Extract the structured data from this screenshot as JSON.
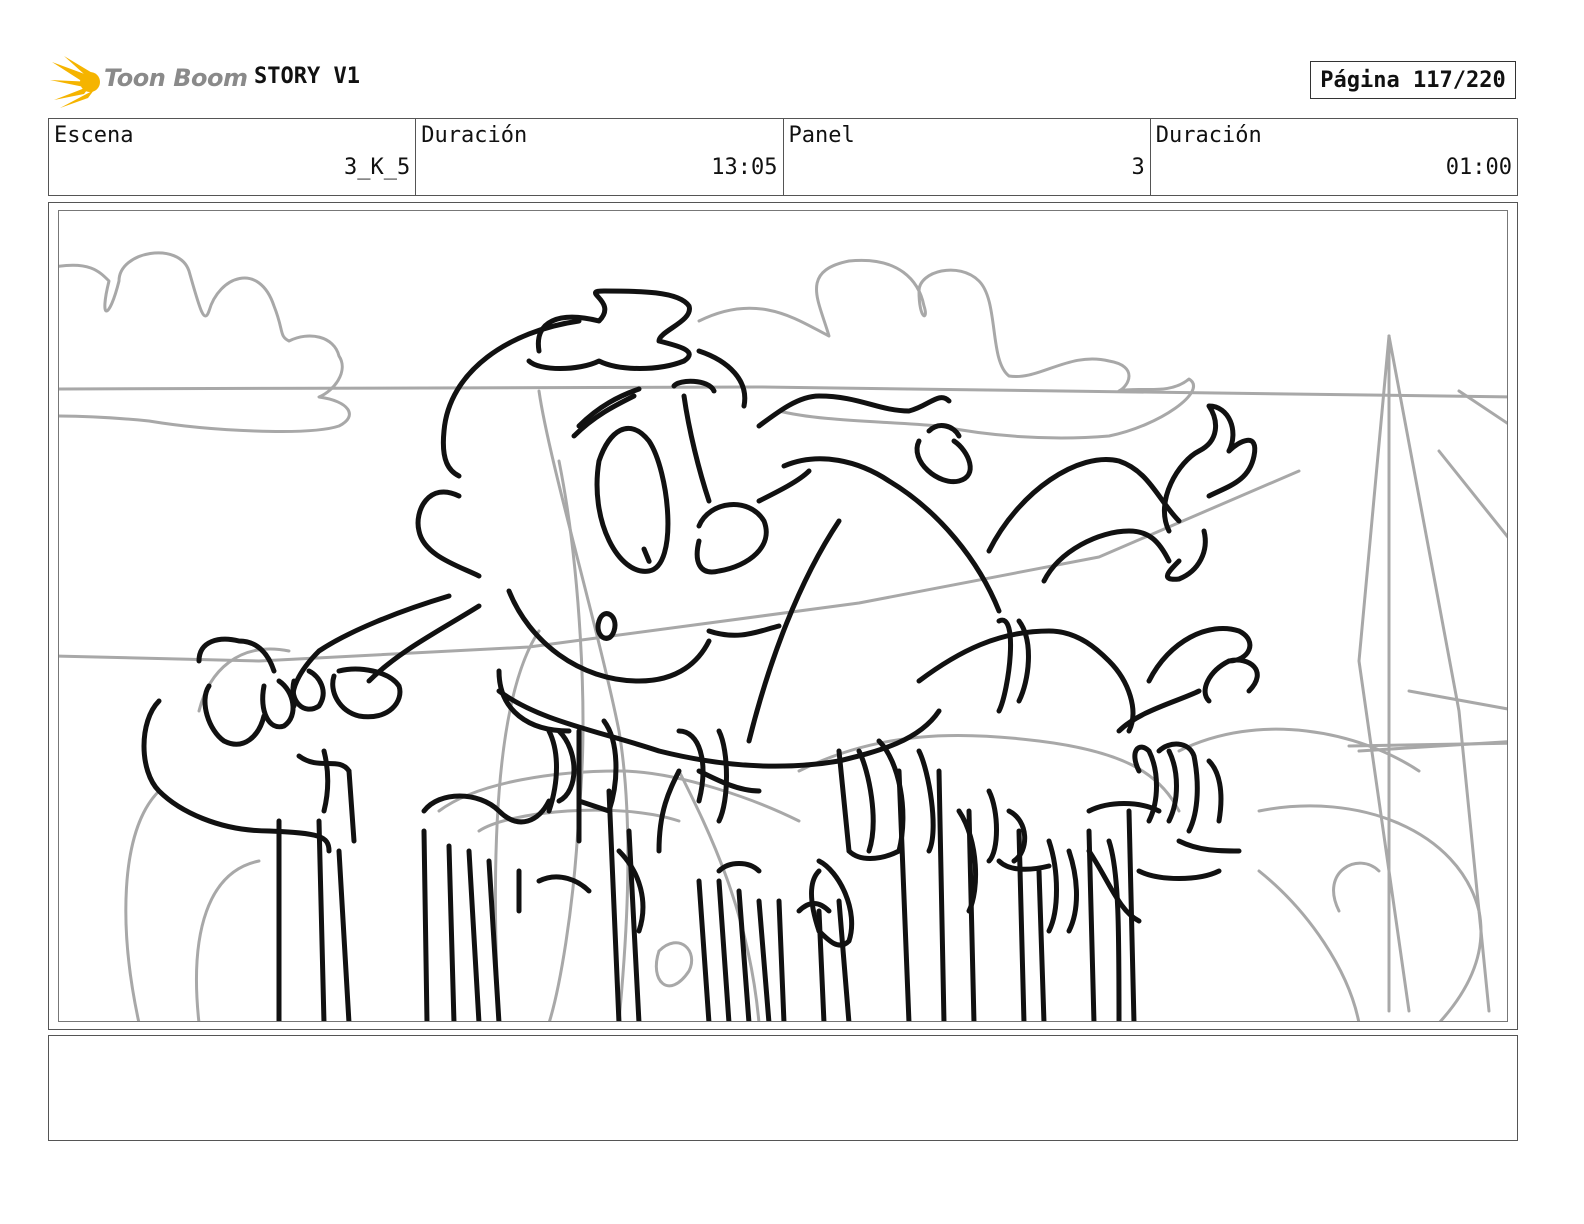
{
  "header": {
    "logo_text": "Toon Boom",
    "project_title": "STORY V1",
    "page_label": "Página 117/220"
  },
  "info": {
    "scene_label": "Escena",
    "scene_value": "3_K_5",
    "scene_duration_label": "Duración",
    "scene_duration_value": "13:05",
    "panel_label": "Panel",
    "panel_value": "3",
    "panel_duration_label": "Duración",
    "panel_duration_value": "01:00"
  },
  "notes": {
    "text": ""
  },
  "colors": {
    "logo_accent": "#f5b400",
    "sketch_line": "#111111",
    "background_sketch": "#a8a8a8"
  }
}
